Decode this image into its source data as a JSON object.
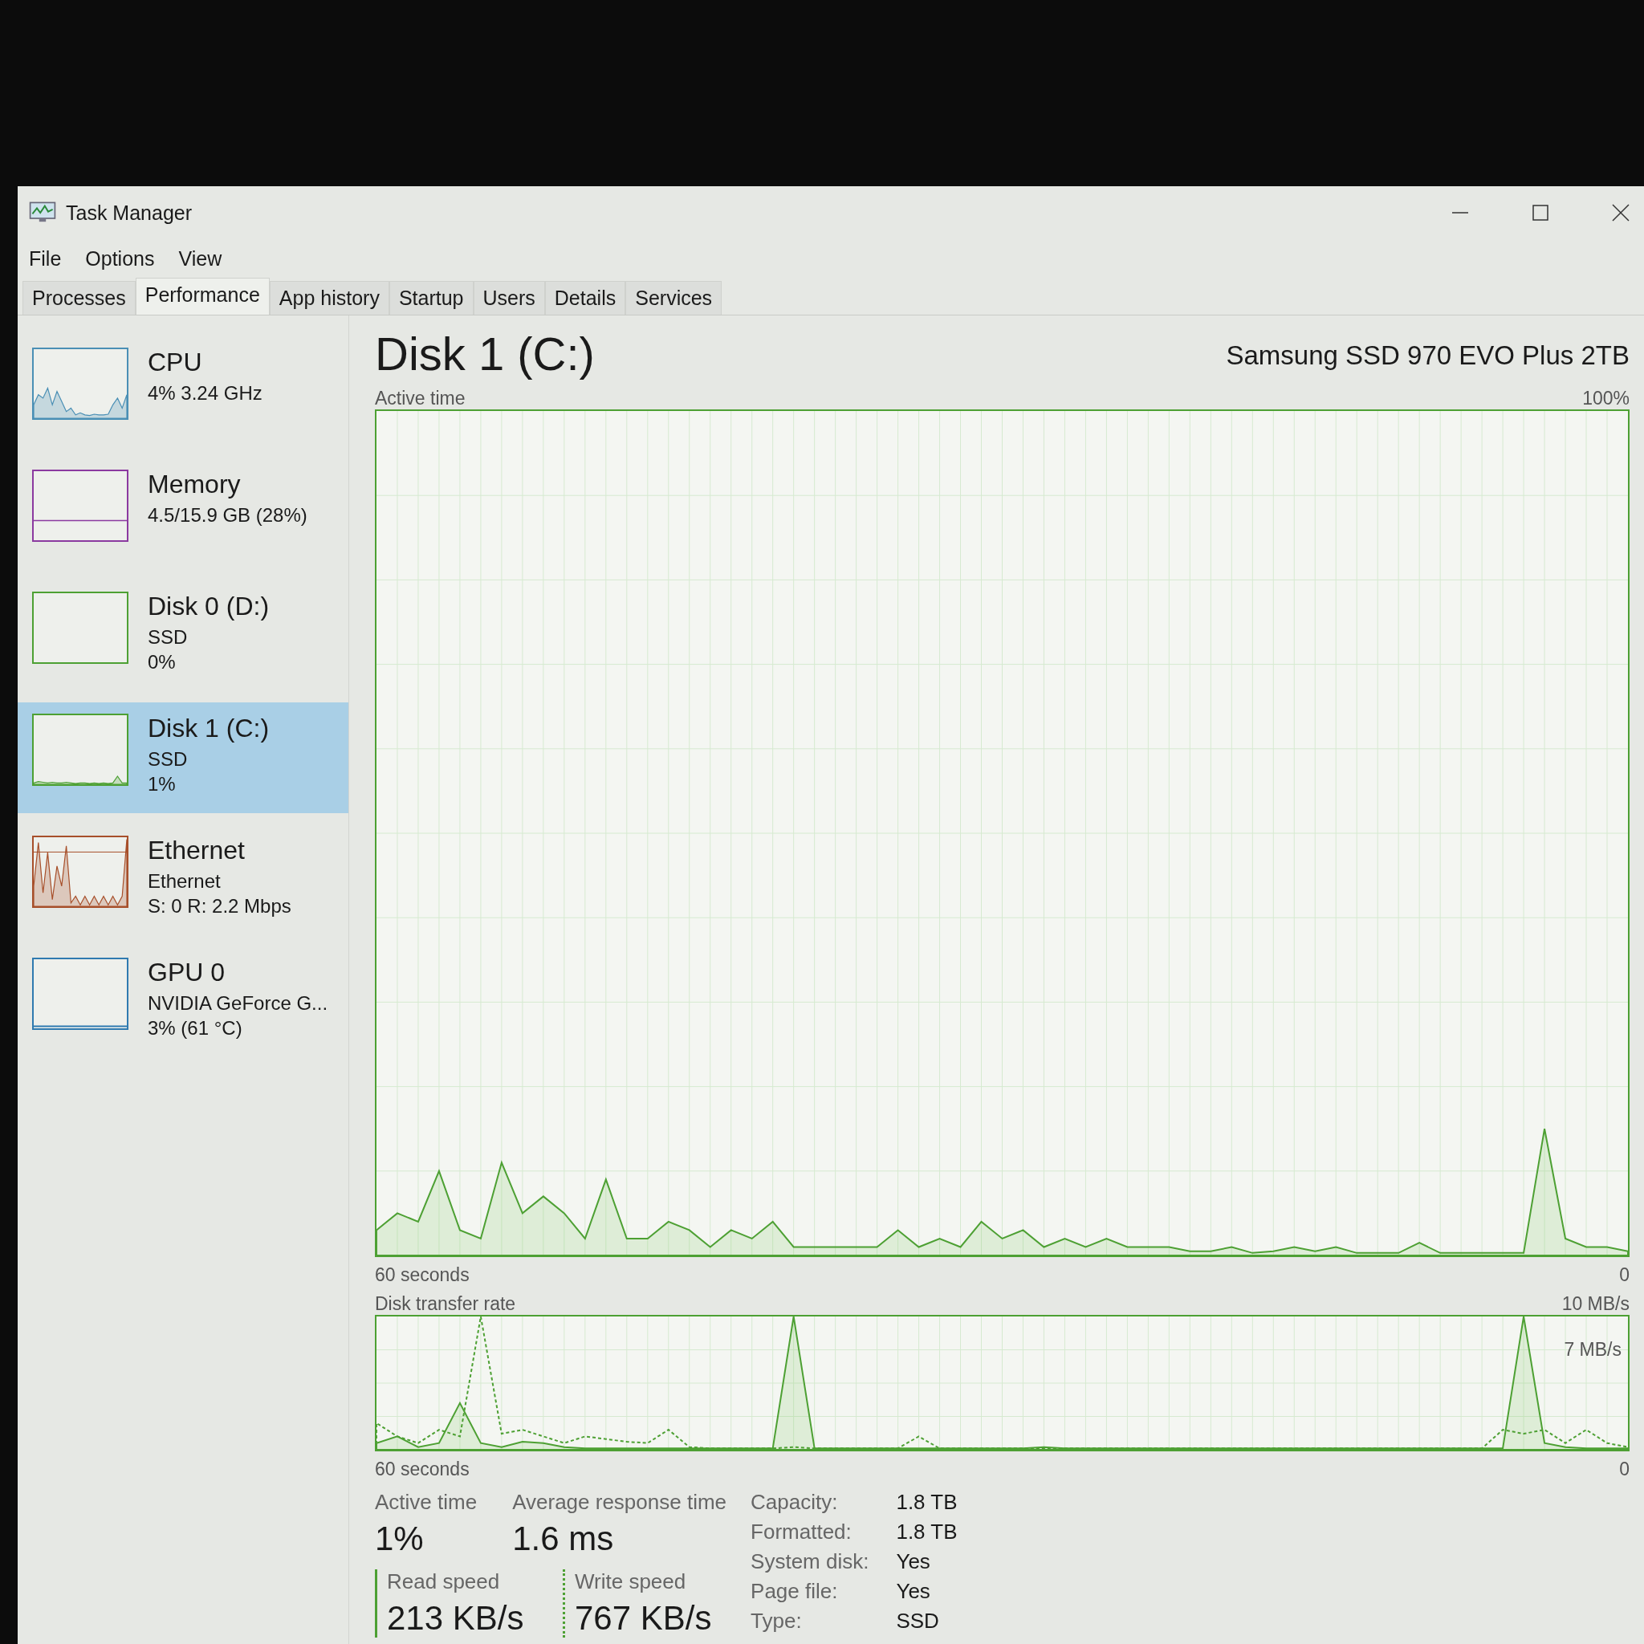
{
  "window": {
    "title": "Task Manager"
  },
  "menu": [
    "File",
    "Options",
    "View"
  ],
  "tabs": [
    {
      "label": "Processes",
      "selected": false
    },
    {
      "label": "Performance",
      "selected": true
    },
    {
      "label": "App history",
      "selected": false
    },
    {
      "label": "Startup",
      "selected": false
    },
    {
      "label": "Users",
      "selected": false
    },
    {
      "label": "Details",
      "selected": false
    },
    {
      "label": "Services",
      "selected": false
    }
  ],
  "sidebar": {
    "items": [
      {
        "kind": "cpu",
        "name": "CPU",
        "details": [
          "4% 3.24 GHz"
        ],
        "color": "#4a8fb5",
        "selected": false
      },
      {
        "kind": "memory",
        "name": "Memory",
        "details": [
          "4.5/15.9 GB (28%)"
        ],
        "color": "#8b3aa0",
        "selected": false
      },
      {
        "kind": "disk",
        "name": "Disk 0 (D:)",
        "details": [
          "SSD",
          "0%"
        ],
        "color": "#4da033",
        "selected": false
      },
      {
        "kind": "disk_active",
        "name": "Disk 1 (C:)",
        "details": [
          "SSD",
          "1%"
        ],
        "color": "#4da033",
        "selected": true
      },
      {
        "kind": "network",
        "name": "Ethernet",
        "details": [
          "Ethernet",
          "S: 0 R: 2.2 Mbps"
        ],
        "color": "#a74f2a",
        "selected": false
      },
      {
        "kind": "gpu",
        "name": "GPU 0",
        "details": [
          "NVIDIA GeForce G...",
          "3% (61 °C)"
        ],
        "color": "#2f7ab0",
        "selected": false
      }
    ]
  },
  "detail": {
    "title": "Disk 1 (C:)",
    "model": "Samsung SSD 970 EVO Plus 2TB",
    "active_graph": {
      "label": "Active time",
      "max": "100%",
      "time": "60 seconds",
      "min": "0"
    },
    "transfer_graph": {
      "label": "Disk transfer rate",
      "max": "10 MB/s",
      "mid": "7 MB/s",
      "time": "60 seconds",
      "min": "0"
    },
    "stats": [
      {
        "label": "Active time",
        "value": "1%"
      },
      {
        "label": "Average response time",
        "value": "1.6 ms"
      }
    ],
    "speeds": [
      {
        "kind": "solid",
        "label": "Read speed",
        "value": "213 KB/s"
      },
      {
        "kind": "dotted",
        "label": "Write speed",
        "value": "767 KB/s"
      }
    ],
    "properties": [
      {
        "label": "Capacity:",
        "value": "1.8 TB"
      },
      {
        "label": "Formatted:",
        "value": "1.8 TB"
      },
      {
        "label": "System disk:",
        "value": "Yes"
      },
      {
        "label": "Page file:",
        "value": "Yes"
      },
      {
        "label": "Type:",
        "value": "SSD"
      }
    ]
  }
}
